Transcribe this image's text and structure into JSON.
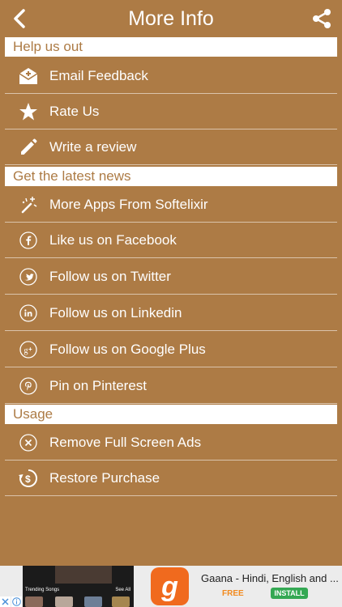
{
  "header": {
    "title": "More Info"
  },
  "sections": [
    {
      "title": "Help us out",
      "items": [
        {
          "label": "Email Feedback",
          "icon": "envelope-icon"
        },
        {
          "label": "Rate Us",
          "icon": "star-icon"
        },
        {
          "label": "Write a review",
          "icon": "pencil-icon"
        }
      ]
    },
    {
      "title": "Get the latest news",
      "items": [
        {
          "label": "More Apps From Softelixir",
          "icon": "sparkle-wand-icon"
        },
        {
          "label": "Like us on Facebook",
          "icon": "facebook-icon"
        },
        {
          "label": "Follow us on Twitter",
          "icon": "twitter-icon"
        },
        {
          "label": "Follow us on Linkedin",
          "icon": "linkedin-icon"
        },
        {
          "label": "Follow us on Google Plus",
          "icon": "google-plus-icon"
        },
        {
          "label": "Pin on Pinterest",
          "icon": "pinterest-icon"
        }
      ]
    },
    {
      "title": "Usage",
      "items": [
        {
          "label": "Remove Full Screen Ads",
          "icon": "close-circle-icon"
        },
        {
          "label": "Restore Purchase",
          "icon": "restore-purchase-icon"
        }
      ]
    }
  ],
  "ad": {
    "preview_label": "Trending Songs",
    "preview_see_all": "See All",
    "app_letter": "g",
    "app_title": "Gaana - Hindi, English and ...",
    "price": "FREE",
    "install_label": "INSTALL"
  },
  "colors": {
    "background": "#ad7b45",
    "section_header_bg": "#ffffff",
    "section_header_text": "#ad7b45",
    "text": "#ffffff"
  }
}
